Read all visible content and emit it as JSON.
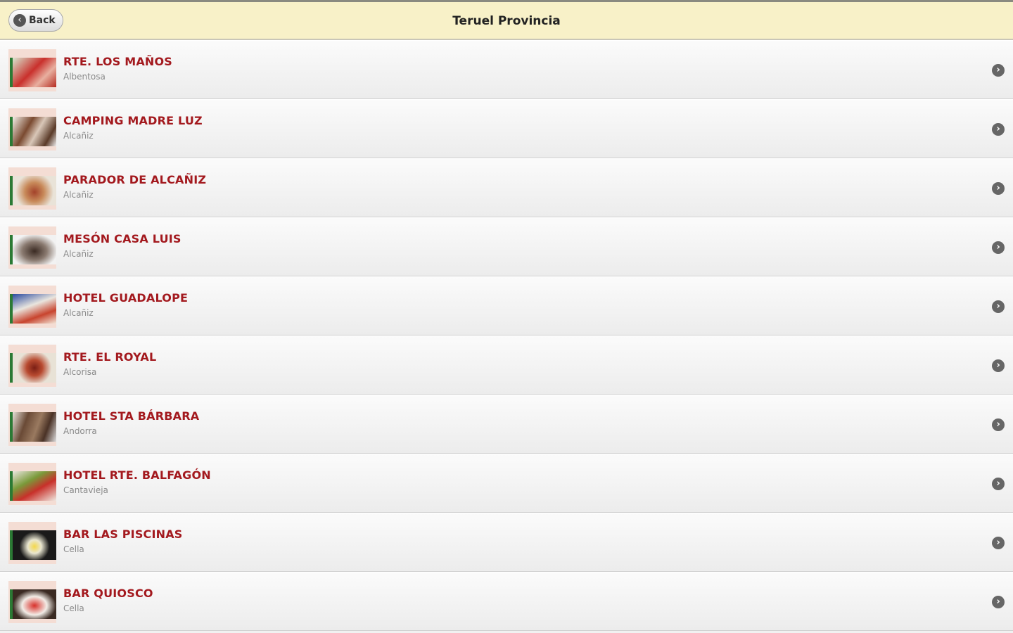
{
  "header": {
    "back_label": "Back",
    "title": "Teruel Provincia"
  },
  "list": {
    "items": [
      {
        "name": "RTE. LOS MAÑOS",
        "town": "Albentosa"
      },
      {
        "name": "CAMPING MADRE LUZ",
        "town": "Alcañiz"
      },
      {
        "name": "PARADOR DE ALCAÑIZ",
        "town": "Alcañiz"
      },
      {
        "name": "MESÓN CASA LUIS",
        "town": "Alcañiz"
      },
      {
        "name": "HOTEL GUADALOPE",
        "town": "Alcañiz"
      },
      {
        "name": "RTE. EL ROYAL",
        "town": "Alcorisa"
      },
      {
        "name": "HOTEL STA BÁRBARA",
        "town": "Andorra"
      },
      {
        "name": "HOTEL RTE. BALFAGÓN",
        "town": "Cantavieja"
      },
      {
        "name": "BAR LAS PISCINAS",
        "town": "Cella"
      },
      {
        "name": "BAR QUIOSCO",
        "town": "Cella"
      }
    ]
  },
  "colors": {
    "header_bg": "#f8f1c8",
    "item_name": "#a3191e",
    "item_town": "#8a8a8a"
  },
  "icons": {
    "back": "chevron-left-circle-icon",
    "row_arrow": "chevron-right-circle-icon"
  }
}
